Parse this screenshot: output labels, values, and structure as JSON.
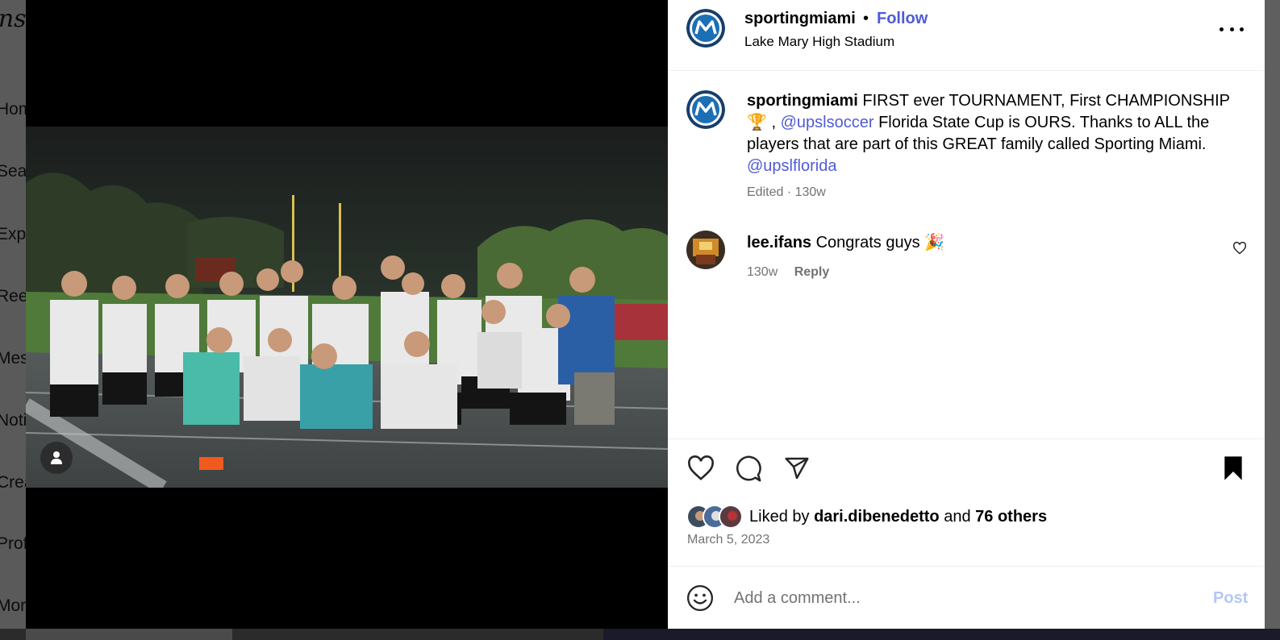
{
  "background": {
    "app_logo": "Instagram",
    "nav_items": [
      "Home",
      "Search",
      "Explore",
      "Reels",
      "Messages",
      "Notifications",
      "Create",
      "Profile",
      "More"
    ]
  },
  "media": {
    "image": "team-celebration-photo",
    "user_tag_icon": "person-icon"
  },
  "post": {
    "author": "sportingmiami",
    "dot": "•",
    "follow_label": "Follow",
    "location": "Lake Mary High Stadium",
    "more_icon": "ellipsis-icon",
    "caption": {
      "username": "sportingmiami",
      "part1": "FIRST ever TOURNAMENT, First CHAMPIONSHIP",
      "trophy": "🏆",
      "part2": " ,",
      "mention1": "@upslsoccer",
      "part3": "Florida State Cup is OURS. Thanks to ALL the players that are part of this GREAT family called Sporting Miami.",
      "mention2": "@upslflorida"
    },
    "caption_meta": "Edited · 130w",
    "comment": {
      "username": "lee.ifans",
      "text": "Congrats guys",
      "emoji": "🎉",
      "time": "130w",
      "reply_label": "Reply"
    },
    "likes": {
      "prefix": "Liked by",
      "first_liker": "dari.dibenedetto",
      "and": "and",
      "others": "76 others"
    },
    "date": "March 5, 2023",
    "comment_placeholder": "Add a comment...",
    "post_label": "Post"
  },
  "colors": {
    "accent": "#4f5bd5",
    "post_disabled": "#b3c7f7",
    "muted": "#737373",
    "logo_blue": "#1b6fb5",
    "logo_navy": "#173e6c"
  }
}
